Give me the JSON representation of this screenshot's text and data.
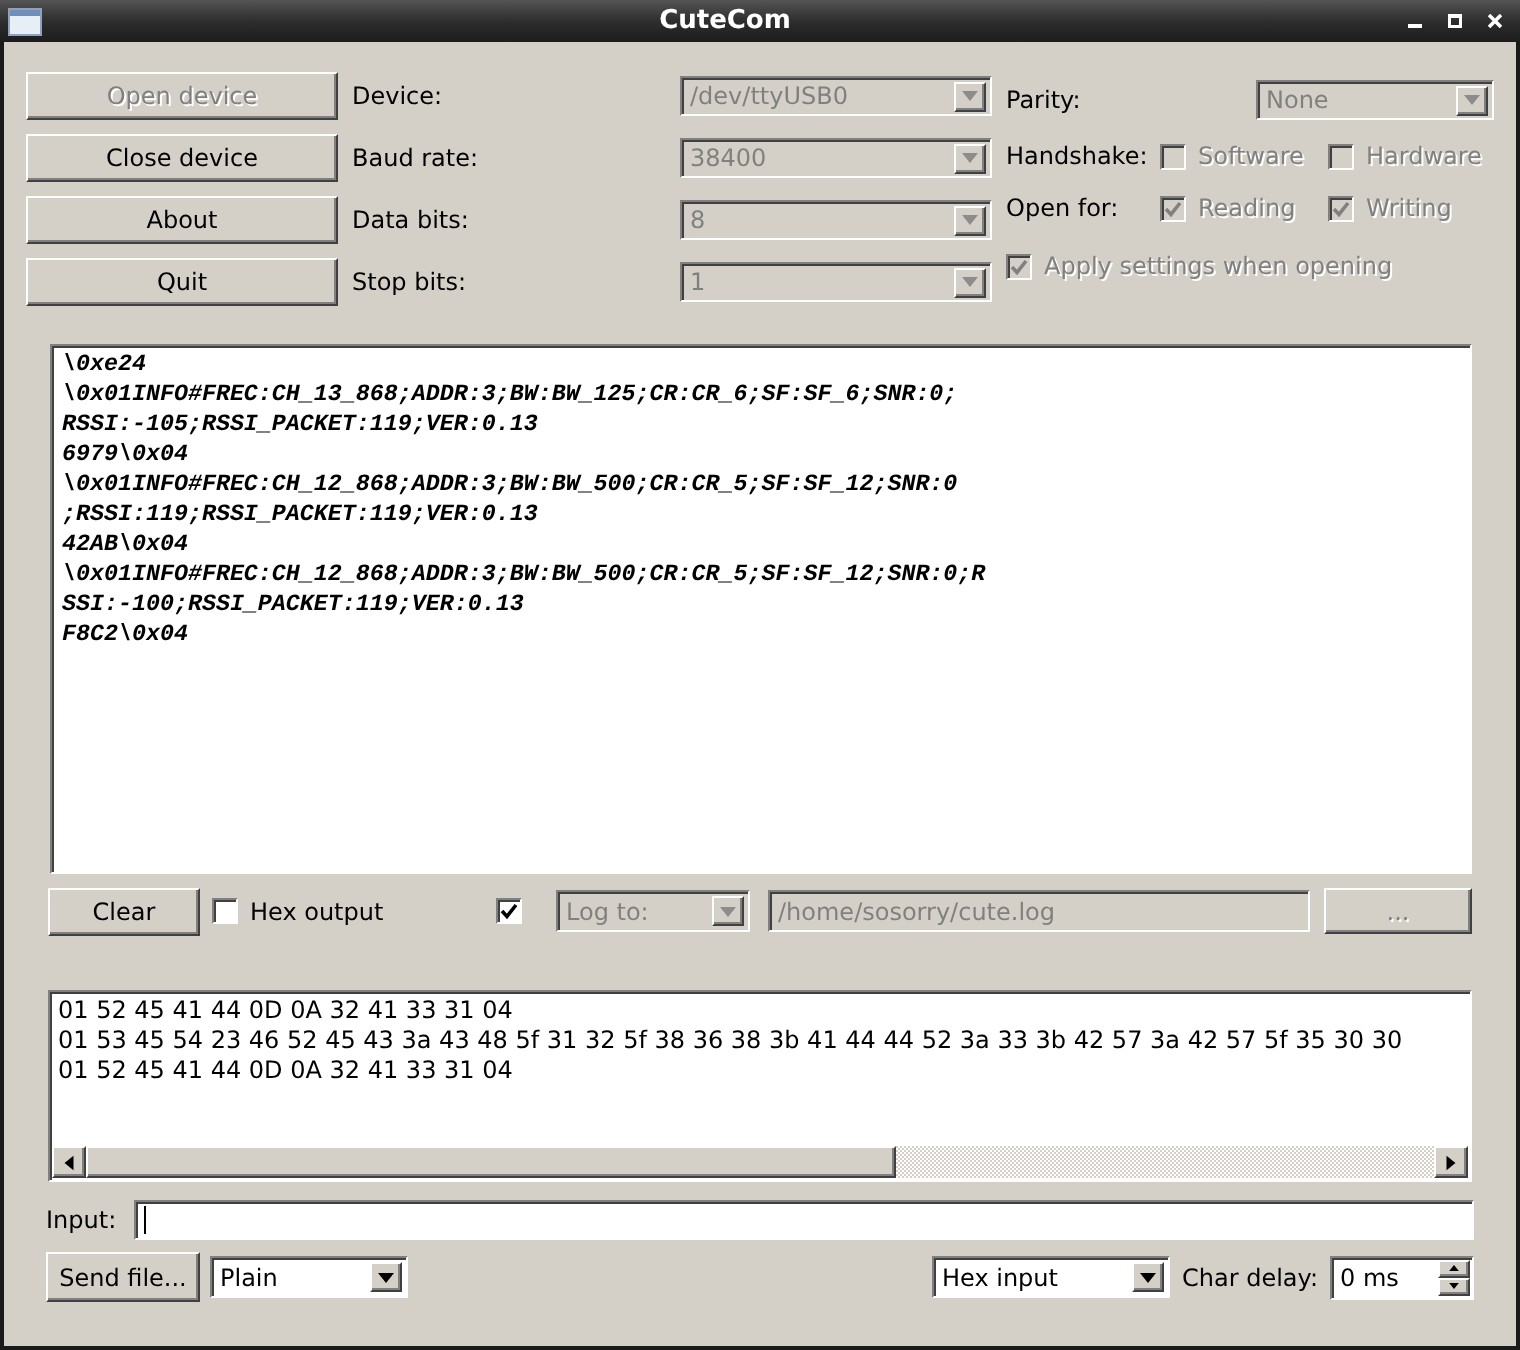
{
  "window": {
    "title": "CuteCom"
  },
  "device_buttons": [
    {
      "label": "Open device",
      "disabled": true
    },
    {
      "label": "Close device",
      "disabled": false
    },
    {
      "label": "About",
      "disabled": false
    },
    {
      "label": "Quit",
      "disabled": false
    }
  ],
  "port_settings": [
    {
      "label": "Device:",
      "value": "/dev/ttyUSB0",
      "disabled": true
    },
    {
      "label": "Baud rate:",
      "value": "38400",
      "disabled": true
    },
    {
      "label": "Data bits:",
      "value": "8",
      "disabled": true
    },
    {
      "label": "Stop bits:",
      "value": "1",
      "disabled": true
    }
  ],
  "parity": {
    "label": "Parity:",
    "value": "None",
    "disabled": true
  },
  "handshake": {
    "label": "Handshake:",
    "options": [
      {
        "label": "Software",
        "checked": false,
        "disabled": true
      },
      {
        "label": "Hardware",
        "checked": false,
        "disabled": true
      }
    ]
  },
  "open_for": {
    "label": "Open for:",
    "options": [
      {
        "label": "Reading",
        "checked": true,
        "disabled": true
      },
      {
        "label": "Writing",
        "checked": true,
        "disabled": true
      }
    ]
  },
  "apply_settings": {
    "label": "Apply settings when opening",
    "checked": true,
    "disabled": true
  },
  "output": {
    "lines": [
      "\\0xe24",
      "\\0x01INFO#FREC:CH_13_868;ADDR:3;BW:BW_125;CR:CR_6;SF:SF_6;SNR:0;",
      "RSSI:-105;RSSI_PACKET:119;VER:0.13",
      "6979\\0x04",
      "\\0x01INFO#FREC:CH_12_868;ADDR:3;BW:BW_500;CR:CR_5;SF:SF_12;SNR:0",
      ";RSSI:119;RSSI_PACKET:119;VER:0.13",
      "42AB\\0x04",
      "\\0x01INFO#FREC:CH_12_868;ADDR:3;BW:BW_500;CR:CR_5;SF:SF_12;SNR:0;R",
      "SSI:-100;RSSI_PACKET:119;VER:0.13",
      "F8C2\\0x04"
    ]
  },
  "output_controls": {
    "clear_button": {
      "label": "Clear",
      "disabled": false
    },
    "hex_output": {
      "label": "Hex output",
      "checked": false,
      "disabled": false
    },
    "log_enable": {
      "checked": true,
      "disabled": false
    },
    "log_target": {
      "value": "Log to:",
      "disabled": true
    },
    "log_file": {
      "value": "/home/sosorry/cute.log",
      "disabled": true
    },
    "browse_button": {
      "label": "...",
      "disabled": true
    }
  },
  "hex_view": {
    "lines": [
      "01 52 45 41 44 0D 0A 32 41 33 31 04",
      "01 53 45 54 23 46 52 45 43 3a 43 48 5f 31 32 5f 38 36 38 3b 41 44 44 52 3a 33 3b 42 57 3a 42 57 5f 35 30 30",
      "01 52 45 41 44 0D 0A 32 41 33 31 04"
    ]
  },
  "input": {
    "label": "Input:",
    "focused": true
  },
  "send_bar": {
    "send_file_button": {
      "label": "Send file...",
      "disabled": false
    },
    "send_mode": {
      "value": "Plain",
      "disabled": false
    },
    "input_mode": {
      "value": "Hex input",
      "disabled": false
    },
    "char_delay": {
      "label": "Char delay:",
      "value": "0 ms"
    }
  }
}
